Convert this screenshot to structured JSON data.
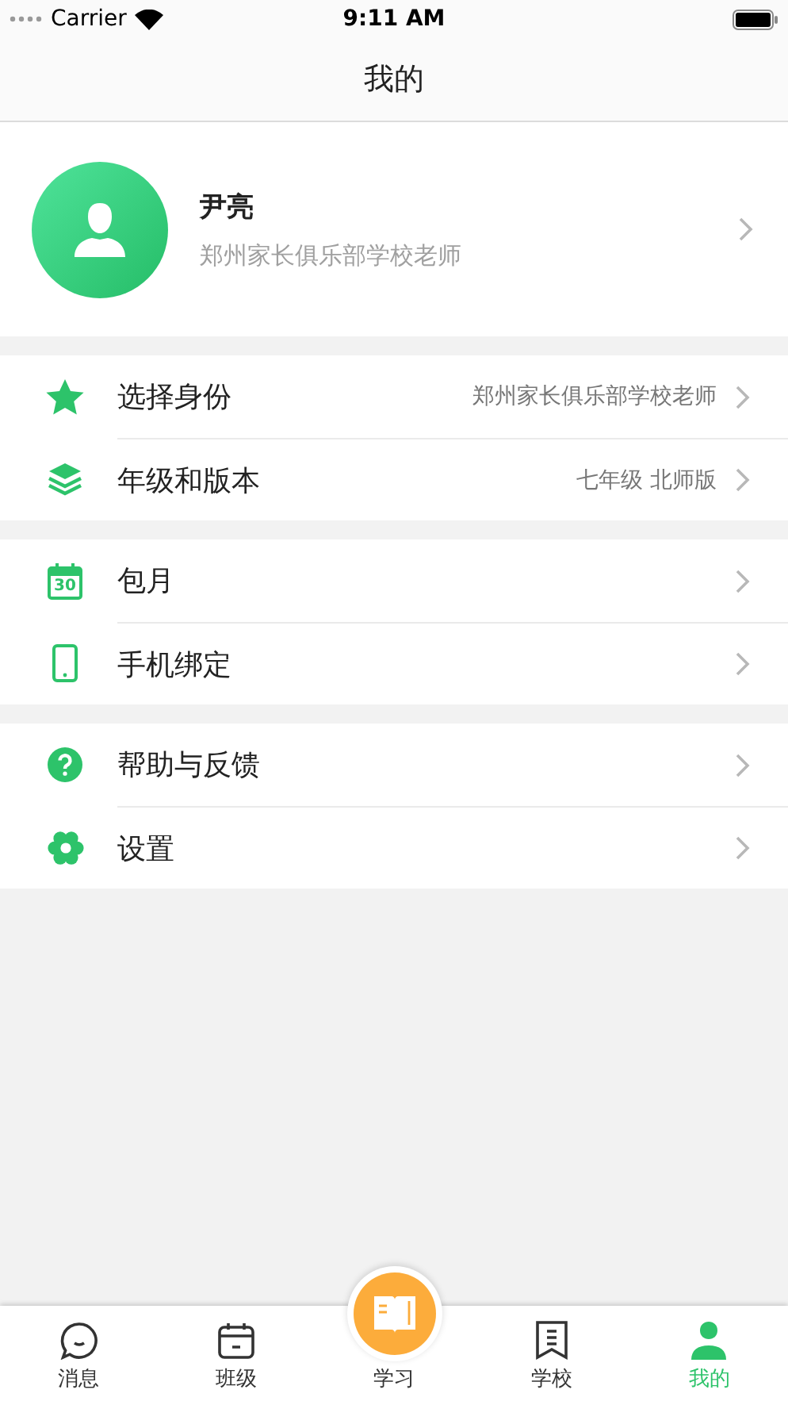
{
  "status_bar": {
    "carrier": "Carrier",
    "time": "9:11 AM"
  },
  "nav": {
    "title": "我的"
  },
  "profile": {
    "name": "尹亮",
    "subtitle": "郑州家长俱乐部学校老师"
  },
  "groups": [
    {
      "items": [
        {
          "kind": "star",
          "label": "选择身份",
          "value": "郑州家长俱乐部学校老师"
        },
        {
          "kind": "layers",
          "label": "年级和版本",
          "value": "七年级 北师版"
        }
      ]
    },
    {
      "items": [
        {
          "kind": "calendar",
          "label": "包月",
          "badge": "30"
        },
        {
          "kind": "phone",
          "label": "手机绑定"
        }
      ]
    },
    {
      "items": [
        {
          "kind": "help",
          "label": "帮助与反馈"
        },
        {
          "kind": "gear",
          "label": "设置"
        }
      ]
    }
  ],
  "tabs": [
    {
      "kind": "chat",
      "label": "消息",
      "selected": false
    },
    {
      "kind": "calendar",
      "label": "班级",
      "selected": false
    },
    {
      "kind": "book",
      "label": "学习",
      "selected": false
    },
    {
      "kind": "bookmark",
      "label": "学校",
      "selected": false
    },
    {
      "kind": "user",
      "label": "我的",
      "selected": true
    }
  ]
}
